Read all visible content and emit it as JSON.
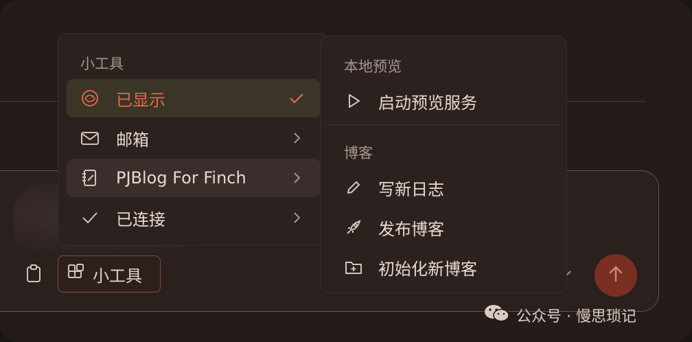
{
  "toolbar": {
    "tools_label": "小工具"
  },
  "tools_menu": {
    "header": "小工具",
    "items": [
      {
        "label": "已显示",
        "icon": "chicken-icon",
        "right": "checkmark-icon",
        "selected": true
      },
      {
        "label": "邮箱",
        "icon": "mail-icon",
        "right": "chevron-right-icon"
      },
      {
        "label": "PJBlog For Finch",
        "icon": "notebook-edit-icon",
        "right": "chevron-right-icon"
      },
      {
        "label": "已连接",
        "icon": "check-icon",
        "right": "chevron-right-icon"
      }
    ]
  },
  "submenu": {
    "sections": [
      {
        "header": "本地预览",
        "items": [
          {
            "label": "启动预览服务",
            "icon": "play-icon"
          }
        ]
      },
      {
        "header": "博客",
        "items": [
          {
            "label": "写新日志",
            "icon": "pencil-icon"
          },
          {
            "label": "发布博客",
            "icon": "rocket-icon"
          },
          {
            "label": "初始化新博客",
            "icon": "folder-plus-icon"
          }
        ]
      }
    ]
  },
  "watermark": {
    "text": "公众号 · 慢思琐记",
    "icon": "wechat-icon"
  },
  "colors": {
    "accent": "#e7684f",
    "send_button": "#7a2f22",
    "background": "#241c1a"
  }
}
